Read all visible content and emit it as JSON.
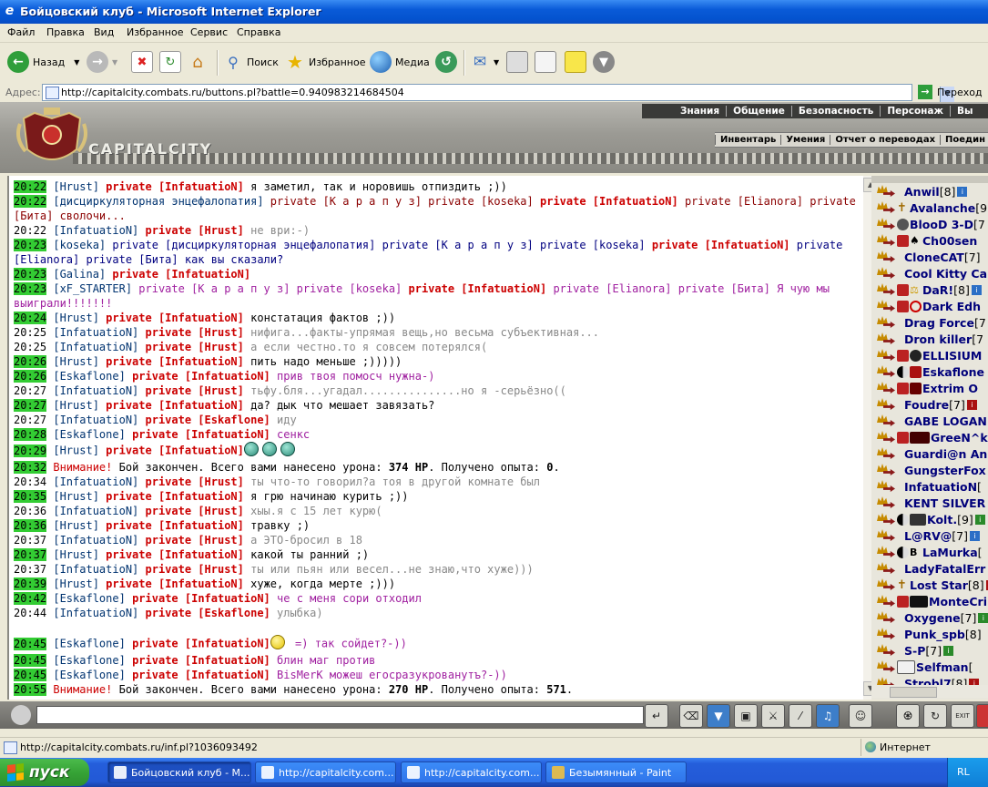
{
  "window": {
    "title": "Бойцовский клуб - Microsoft Internet Explorer"
  },
  "menu": [
    "Файл",
    "Правка",
    "Вид",
    "Избранное",
    "Сервис",
    "Справка"
  ],
  "toolbar": {
    "back_label": "Назад",
    "search_label": "Поиск",
    "favorites_label": "Избранное",
    "media_label": "Медиа"
  },
  "address": {
    "label": "Адрес:",
    "url": "http://capitalcity.combats.ru/buttons.pl?battle=0.940983214684504",
    "go_label": "Переход"
  },
  "game": {
    "logo_text": "CAPITALCITY",
    "top_nav": [
      "Знания",
      "Общение",
      "Безопасность",
      "Персонаж",
      "Вы"
    ],
    "sub_nav": [
      "Инвентарь",
      "Умения",
      "Отчет о переводах",
      "Поедин"
    ]
  },
  "chat": [
    {
      "time": "20:22",
      "hl": true,
      "parts": [
        [
          "nick",
          "[Hrust]"
        ],
        [
          "pvt",
          " private [InfatuatioN]"
        ],
        [
          "msg",
          " я заметил, так и норовишь отпиздить ;))"
        ]
      ]
    },
    {
      "time": "20:22",
      "hl": true,
      "parts": [
        [
          "nick",
          "[дисциркуляторная энцефалопатия]"
        ],
        [
          "pvtn",
          " private [К а р а п у з]"
        ],
        [
          "pvtn",
          " private [koseka]"
        ],
        [
          "pvt",
          " private [InfatuatioN]"
        ],
        [
          "pvtn",
          " private [Elianora]"
        ],
        [
          "pvtn",
          " private [Бита]"
        ],
        [
          "pvtn",
          " сволочи..."
        ]
      ]
    },
    {
      "time": "20:22",
      "hl": false,
      "parts": [
        [
          "nick",
          "[InfatuatioN]"
        ],
        [
          "pvt",
          " private [Hrust]"
        ],
        [
          "gray",
          " не ври:-)"
        ]
      ]
    },
    {
      "time": "20:23",
      "hl": true,
      "parts": [
        [
          "nick",
          "[koseka]"
        ],
        [
          "blue",
          " private [дисциркуляторная энцефалопатия]"
        ],
        [
          "blue",
          " private [К а р а п у з]"
        ],
        [
          "blue",
          " private [koseka]"
        ],
        [
          "pvt",
          " private [InfatuatioN]"
        ],
        [
          "blue",
          " private [Elianora]"
        ],
        [
          "blue",
          " private [Бита]"
        ],
        [
          "blue",
          " как вы сказали?"
        ]
      ]
    },
    {
      "time": "20:23",
      "hl": true,
      "parts": [
        [
          "nick",
          "[Galina]"
        ],
        [
          "pvt",
          " private [InfatuatioN]"
        ]
      ]
    },
    {
      "time": "20:23",
      "hl": true,
      "parts": [
        [
          "nick",
          "[xF_STARTER]"
        ],
        [
          "purple",
          " private [К а р а п у з]"
        ],
        [
          "purple",
          " private [koseka]"
        ],
        [
          "pvt",
          " private [InfatuatioN]"
        ],
        [
          "purple",
          " private [Elianora]"
        ],
        [
          "purple",
          " private [Бита]"
        ],
        [
          "purple",
          " Я чую мы выиграли!!!!!!!"
        ]
      ]
    },
    {
      "time": "20:24",
      "hl": true,
      "parts": [
        [
          "nick",
          "[Hrust]"
        ],
        [
          "pvt",
          " private [InfatuatioN]"
        ],
        [
          "msg",
          " констатация фактов ;))"
        ]
      ]
    },
    {
      "time": "20:25",
      "hl": false,
      "parts": [
        [
          "nick",
          "[InfatuatioN]"
        ],
        [
          "pvt",
          " private [Hrust]"
        ],
        [
          "gray",
          " нифига...факты-упрямая вещь,но весьма субъективная..."
        ]
      ]
    },
    {
      "time": "20:25",
      "hl": false,
      "parts": [
        [
          "nick",
          "[InfatuatioN]"
        ],
        [
          "pvt",
          " private [Hrust]"
        ],
        [
          "gray",
          " а если честно.то я совсем потерялся("
        ]
      ]
    },
    {
      "time": "20:26",
      "hl": true,
      "parts": [
        [
          "nick",
          "[Hrust]"
        ],
        [
          "pvt",
          " private [InfatuatioN]"
        ],
        [
          "msg",
          " пить надо меньше ;)))))"
        ]
      ]
    },
    {
      "time": "20:26",
      "hl": true,
      "parts": [
        [
          "nick",
          "[Eskaflone]"
        ],
        [
          "pvt",
          " private [InfatuatioN]"
        ],
        [
          "purple",
          " прив твоя помосч нужна-)"
        ]
      ]
    },
    {
      "time": "20:27",
      "hl": false,
      "parts": [
        [
          "nick",
          "[InfatuatioN]"
        ],
        [
          "pvt",
          " private [Hrust]"
        ],
        [
          "gray",
          " тьфу.бля...угадал...............но я -серьёзно(("
        ]
      ]
    },
    {
      "time": "20:27",
      "hl": true,
      "parts": [
        [
          "nick",
          "[Hrust]"
        ],
        [
          "pvt",
          " private [InfatuatioN]"
        ],
        [
          "msg",
          " да? дык что мешает завязать?"
        ]
      ]
    },
    {
      "time": "20:27",
      "hl": false,
      "parts": [
        [
          "nick",
          "[InfatuatioN]"
        ],
        [
          "pvt",
          " private [Eskaflone]"
        ],
        [
          "gray",
          " иду"
        ]
      ]
    },
    {
      "time": "20:28",
      "hl": true,
      "parts": [
        [
          "nick",
          "[Eskaflone]"
        ],
        [
          "pvt",
          " private [InfatuatioN]"
        ],
        [
          "purple",
          " сенкс"
        ]
      ]
    },
    {
      "time": "20:29",
      "hl": true,
      "parts": [
        [
          "nick",
          "[Hrust]"
        ],
        [
          "pvt",
          " private [InfatuatioN]"
        ],
        [
          "smiles",
          "3"
        ]
      ]
    },
    {
      "time": "20:32",
      "hl": true,
      "warn": true,
      "parts": [
        [
          "warn",
          "Внимание!"
        ],
        [
          "msg",
          " Бой закончен. Всего вами нанесено урона: "
        ],
        [
          "bold",
          "374 HP"
        ],
        [
          "msg",
          ". Получено опыта: "
        ],
        [
          "bold",
          "0"
        ],
        [
          "msg",
          "."
        ]
      ]
    },
    {
      "time": "20:34",
      "hl": false,
      "parts": [
        [
          "nick",
          "[InfatuatioN]"
        ],
        [
          "pvt",
          " private [Hrust]"
        ],
        [
          "gray",
          " ты что-то говорил?а тоя в другой комнате был"
        ]
      ]
    },
    {
      "time": "20:35",
      "hl": true,
      "parts": [
        [
          "nick",
          "[Hrust]"
        ],
        [
          "pvt",
          " private [InfatuatioN]"
        ],
        [
          "msg",
          " я грю начинаю курить ;))"
        ]
      ]
    },
    {
      "time": "20:36",
      "hl": false,
      "parts": [
        [
          "nick",
          "[InfatuatioN]"
        ],
        [
          "pvt",
          " private [Hrust]"
        ],
        [
          "gray",
          " хыы.я с 15 лет курю("
        ]
      ]
    },
    {
      "time": "20:36",
      "hl": true,
      "parts": [
        [
          "nick",
          "[Hrust]"
        ],
        [
          "pvt",
          " private [InfatuatioN]"
        ],
        [
          "msg",
          " травку ;)"
        ]
      ]
    },
    {
      "time": "20:37",
      "hl": false,
      "parts": [
        [
          "nick",
          "[InfatuatioN]"
        ],
        [
          "pvt",
          " private [Hrust]"
        ],
        [
          "gray",
          " а ЭТО-бросил в 18"
        ]
      ]
    },
    {
      "time": "20:37",
      "hl": true,
      "parts": [
        [
          "nick",
          "[Hrust]"
        ],
        [
          "pvt",
          " private [InfatuatioN]"
        ],
        [
          "msg",
          " какой ты ранний ;)"
        ]
      ]
    },
    {
      "time": "20:37",
      "hl": false,
      "parts": [
        [
          "nick",
          "[InfatuatioN]"
        ],
        [
          "pvt",
          " private [Hrust]"
        ],
        [
          "gray",
          " ты или пьян или весел...не знаю,что хуже)))"
        ]
      ]
    },
    {
      "time": "20:39",
      "hl": true,
      "parts": [
        [
          "nick",
          "[Hrust]"
        ],
        [
          "pvt",
          " private [InfatuatioN]"
        ],
        [
          "msg",
          " хуже, когда мерте ;)))"
        ]
      ]
    },
    {
      "time": "20:42",
      "hl": true,
      "parts": [
        [
          "nick",
          "[Eskaflone]"
        ],
        [
          "pvt",
          " private [InfatuatioN]"
        ],
        [
          "purple",
          " че с меня сори отходил"
        ]
      ]
    },
    {
      "time": "20:44",
      "hl": false,
      "parts": [
        [
          "nick",
          "[InfatuatioN]"
        ],
        [
          "pvt",
          " private [Eskaflone]"
        ],
        [
          "gray",
          " улыбка)"
        ]
      ]
    },
    {
      "time": "",
      "hl": false,
      "blank": true,
      "parts": []
    },
    {
      "time": "20:45",
      "hl": true,
      "parts": [
        [
          "nick",
          "[Eskaflone]"
        ],
        [
          "pvt",
          " private [InfatuatioN]"
        ],
        [
          "smiley",
          "1"
        ],
        [
          "purple",
          " =) так сойдет?-))"
        ]
      ]
    },
    {
      "time": "20:45",
      "hl": true,
      "parts": [
        [
          "nick",
          "[Eskaflone]"
        ],
        [
          "pvt",
          " private [InfatuatioN]"
        ],
        [
          "purple",
          " блин маг против"
        ]
      ]
    },
    {
      "time": "20:45",
      "hl": true,
      "parts": [
        [
          "nick",
          "[Eskaflone]"
        ],
        [
          "pvt",
          " private [InfatuatioN]"
        ],
        [
          "purple",
          " BisMerK можеш егосразукрованутъ?-))"
        ]
      ]
    },
    {
      "time": "20:55",
      "hl": true,
      "warn": true,
      "parts": [
        [
          "warn",
          "Внимание!"
        ],
        [
          "msg",
          " Бой закончен. Всего вами нанесено урона: "
        ],
        [
          "bold",
          "270 HP"
        ],
        [
          "msg",
          ". Получено опыта: "
        ],
        [
          "bold",
          "571"
        ],
        [
          "msg",
          "."
        ]
      ]
    }
  ],
  "users": [
    {
      "name": "Anwil",
      "level": "[8]",
      "clan": "",
      "info": "i"
    },
    {
      "name": "Avalanche",
      "level": "[9",
      "clan": "cross",
      "info": ""
    },
    {
      "name": "BlooD 3-D",
      "level": "[7",
      "clan": "skull",
      "info": ""
    },
    {
      "name": "Ch00sen",
      "level": "",
      "clan": "red2",
      "info": ""
    },
    {
      "name": "CloneCAT",
      "level": "[7]",
      "clan": "",
      "info": ""
    },
    {
      "name": "Cool Kitty Ca",
      "level": "",
      "clan": "",
      "info": ""
    },
    {
      "name": "DaR!",
      "level": "[8]",
      "clan": "redgold",
      "info": "i"
    },
    {
      "name": "Dark Edh",
      "level": "",
      "clan": "redno",
      "info": ""
    },
    {
      "name": "Drag Force",
      "level": "[7",
      "clan": "",
      "info": ""
    },
    {
      "name": "Dron killer",
      "level": "[7",
      "clan": "",
      "info": ""
    },
    {
      "name": "ELLISIUM",
      "level": "",
      "clan": "redskull",
      "info": ""
    },
    {
      "name": "Eskaflone",
      "level": "",
      "clan": "yinhand",
      "info": ""
    },
    {
      "name": "Extrim O",
      "level": "",
      "clan": "reddevil",
      "info": ""
    },
    {
      "name": "Foudre",
      "level": "[7]",
      "clan": "",
      "info": "r"
    },
    {
      "name": "GABE LOGAN",
      "level": "",
      "clan": "",
      "info": ""
    },
    {
      "name": "GreeN^k",
      "level": "",
      "clan": "redbird",
      "info": ""
    },
    {
      "name": "Guardi@n An",
      "level": "",
      "clan": "",
      "info": ""
    },
    {
      "name": "GungsterFox",
      "level": "",
      "clan": "",
      "info": ""
    },
    {
      "name": "InfatuatioN",
      "level": "[",
      "clan": "",
      "info": ""
    },
    {
      "name": "KENT SILVER",
      "level": "",
      "clan": "",
      "info": ""
    },
    {
      "name": "Kolt.",
      "level": "[9]",
      "clan": "yinwings",
      "info": "g"
    },
    {
      "name": "L@RV@",
      "level": "[7]",
      "clan": "",
      "info": "i"
    },
    {
      "name": "LaMurka",
      "level": "[",
      "clan": "yinbr",
      "info": ""
    },
    {
      "name": "LadyFatalErr",
      "level": "",
      "clan": "",
      "info": ""
    },
    {
      "name": "Lost Star",
      "level": "[8]",
      "clan": "cross",
      "info": "r"
    },
    {
      "name": "MonteCri",
      "level": "",
      "clan": "redbat",
      "info": ""
    },
    {
      "name": "Oxygene",
      "level": "[7]",
      "clan": "",
      "info": "g"
    },
    {
      "name": "Punk_spb",
      "level": "[8]",
      "clan": "",
      "info": ""
    },
    {
      "name": "S-P",
      "level": "[7]",
      "clan": "",
      "info": "g"
    },
    {
      "name": "Selfman",
      "level": "[",
      "clan": "flag",
      "info": ""
    },
    {
      "name": "Strobl7",
      "level": "[8]",
      "clan": "",
      "info": "r"
    }
  ],
  "statusbar": {
    "text": "http://capitalcity.combats.ru/inf.pl?1036093492",
    "zone": "Интернет"
  },
  "taskbar": {
    "start_label": "пуск",
    "buttons": [
      "Бойцовский клуб - М...",
      "http://capitalcity.com...",
      "http://capitalcity.com...",
      "Безымянный - Paint"
    ],
    "lang": "RL"
  }
}
